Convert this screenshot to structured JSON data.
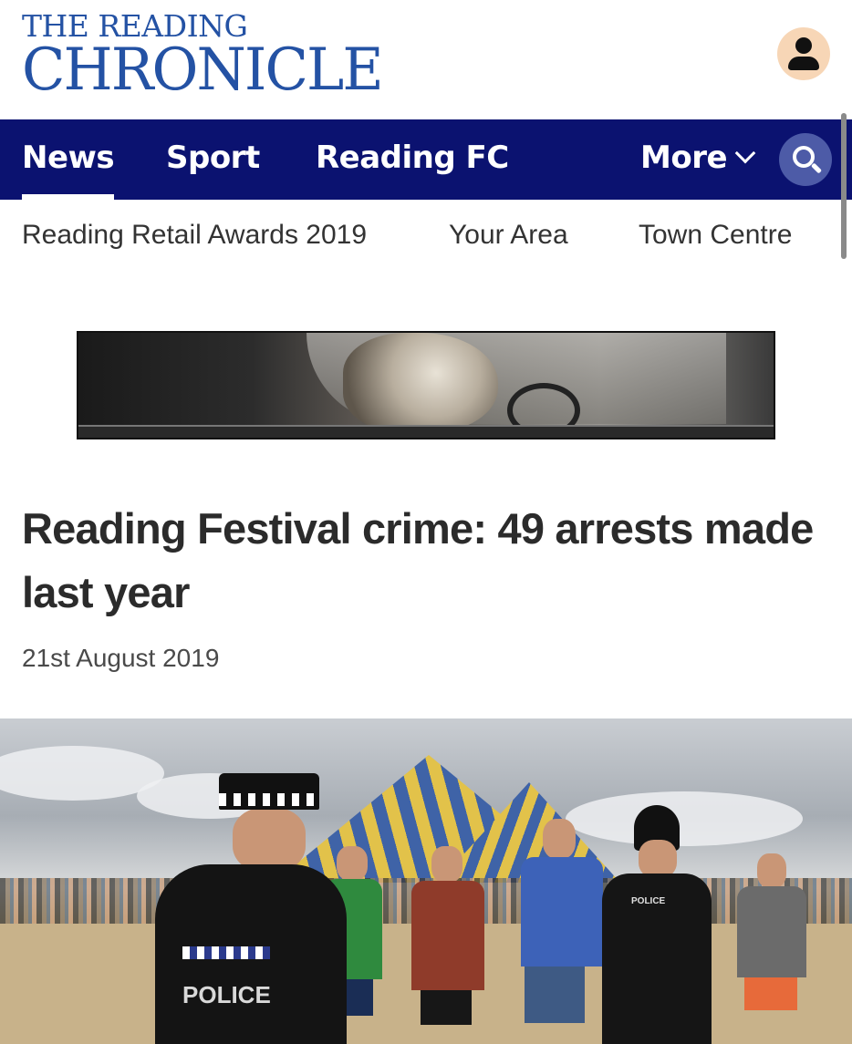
{
  "brand": {
    "line1": "THE READING",
    "line2": "CHRONICLE",
    "color": "#2452a4"
  },
  "header": {
    "account_icon": "user-icon"
  },
  "nav": {
    "background": "#0b1270",
    "items": [
      {
        "label": "News",
        "active": true
      },
      {
        "label": "Sport",
        "active": false
      },
      {
        "label": "Reading FC",
        "active": false
      },
      {
        "label": "More",
        "active": false
      }
    ],
    "more_icon": "chevron-down-icon",
    "search_icon": "search-icon"
  },
  "subnav": {
    "items": [
      {
        "label": "Reading Retail Awards 2019"
      },
      {
        "label": "Your Area"
      },
      {
        "label": "Town Centre"
      }
    ]
  },
  "ad": {
    "image": "advertisement-banner-dog-in-car"
  },
  "article": {
    "headline": "Reading Festival crime: 49 arrests made last year",
    "date": "21st August 2019",
    "image": "festival-police-photo",
    "photo_text": {
      "officer_label": "POLICE",
      "officer2_label": "POLICE"
    }
  }
}
